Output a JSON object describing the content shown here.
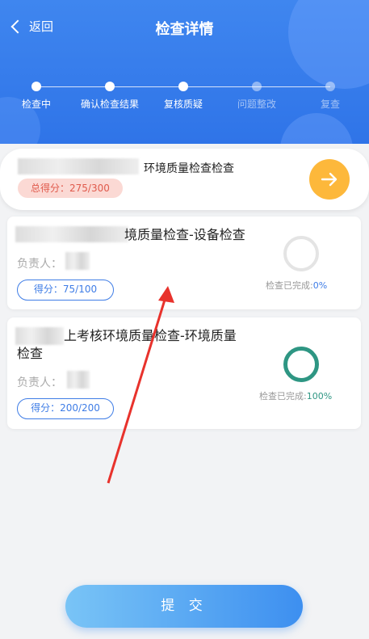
{
  "header": {
    "back_label": "返回",
    "title": "检查详情",
    "steps": [
      {
        "label": "检查中",
        "active": true
      },
      {
        "label": "确认检查结果",
        "active": true
      },
      {
        "label": "复核质疑",
        "active": true
      },
      {
        "label": "问题整改",
        "active": false
      },
      {
        "label": "复查",
        "active": false
      }
    ]
  },
  "summary": {
    "title": "环境质量检查检查",
    "total_score": "总得分：275/300"
  },
  "cards": [
    {
      "title": "境质量检查-设备检查",
      "owner_label": "负责人：",
      "score": "得分：75/100",
      "progress_label": "检查已完成:",
      "progress_value": "0%",
      "progress": 0,
      "ring_color": "#e4e4e4",
      "value_color": "#3f7de6"
    },
    {
      "title_line1": "上考核环境质量检查-环境质量",
      "title_line2": "检查",
      "owner_label": "负责人：",
      "score": "得分：200/200",
      "progress_label": "检查已完成:",
      "progress_value": "100%",
      "progress": 1,
      "ring_color": "#2e9683",
      "value_color": "#2e9683"
    }
  ],
  "submit_label": "提 交",
  "colors": {
    "header_blue": "#3f86ef",
    "accent_orange": "#fdb83b",
    "score_red": "#e05a4c",
    "accent_blue": "#3f7de6",
    "done_green": "#2e9683",
    "annotation_arrow": "#e8322c"
  }
}
